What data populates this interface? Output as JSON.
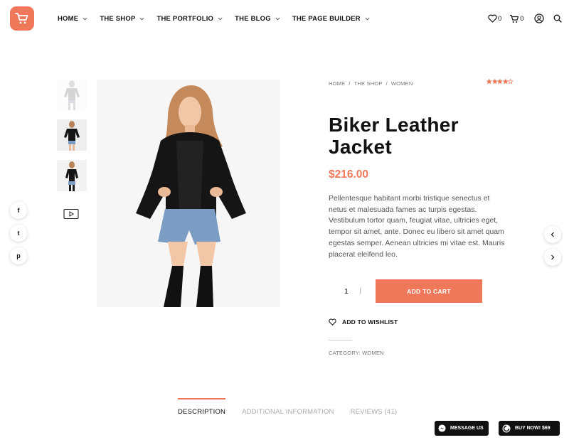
{
  "header": {
    "nav": [
      {
        "label": "HOME"
      },
      {
        "label": "THE SHOP"
      },
      {
        "label": "THE PORTFOLIO"
      },
      {
        "label": "THE BLOG"
      },
      {
        "label": "THE PAGE BUILDER"
      }
    ],
    "wishlist_count": "0",
    "cart_count": "0"
  },
  "breadcrumb": [
    "HOME",
    "/",
    "THE SHOP",
    "/",
    "WOMEN"
  ],
  "product": {
    "title": "Biker Leather Jacket",
    "price": "$216.00",
    "rating": 4,
    "rating_max": 5,
    "description": "Pellentesque habitant morbi tristique senectus et netus et malesuada fames ac turpis egestas. Vestibulum tortor quam, feugiat vitae, ultricies eget, tempor sit amet, ante. Donec eu libero sit amet quam egestas semper. Aenean ultricies mi vitae est. Mauris placerat eleifend leo.",
    "quantity": "1",
    "add_to_cart": "ADD TO CART",
    "wishlist": "ADD TO WISHLIST",
    "category": "CATEGORY: WOMEN"
  },
  "tabs": [
    {
      "label": "DESCRIPTION",
      "active": true
    },
    {
      "label": "ADDITIONAL INFORMATION",
      "active": false
    },
    {
      "label": "REVIEWS (41)",
      "active": false
    }
  ],
  "social": [
    {
      "icon": "facebook-icon",
      "glyph": "f"
    },
    {
      "icon": "twitter-icon",
      "glyph": "t"
    },
    {
      "icon": "pinterest-icon",
      "glyph": "p"
    }
  ],
  "bottom": {
    "message": "MESSAGE US",
    "buy": "BUY NOW! $69"
  },
  "colors": {
    "accent": "#ee7859",
    "text": "#111111",
    "muted": "#777777"
  }
}
